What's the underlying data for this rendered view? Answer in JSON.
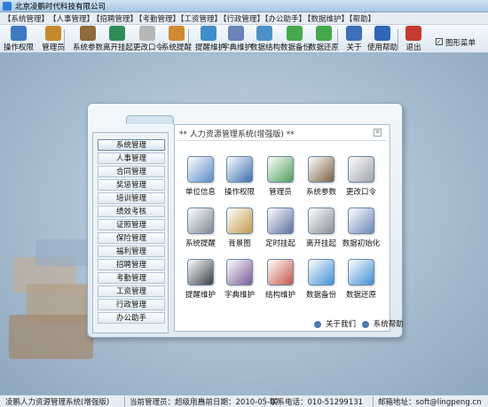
{
  "window": {
    "title": "北京凌鹏时代科技有限公司"
  },
  "menu": [
    "【系统管理】",
    "【人事管理】",
    "【招聘管理】",
    "【考勤管理】",
    "【工资管理】",
    "【行政管理】",
    "【办公助手】",
    "【数据维护】",
    "【帮助】"
  ],
  "toolbar": [
    {
      "label": "操作权限",
      "icon": "user-key-icon",
      "color": "#3d7ac1"
    },
    {
      "label": "管理员",
      "icon": "admin-icon",
      "color": "#c58a2c"
    },
    {
      "label": "系统参数",
      "icon": "settings-icon",
      "color": "#8f6a3a"
    },
    {
      "label": "离开挂起",
      "icon": "suspend-icon",
      "color": "#2e8b57"
    },
    {
      "label": "更改口令",
      "icon": "password-icon",
      "color": "#b7b7b7"
    },
    {
      "label": "系统提醒",
      "icon": "reminder-icon",
      "color": "#d08a2f"
    },
    {
      "label": "提醒维护",
      "icon": "reminder-maintain-icon",
      "color": "#3f8ec9"
    },
    {
      "label": "字典维护",
      "icon": "dictionary-icon",
      "color": "#6a83b8"
    },
    {
      "label": "数据结构",
      "icon": "data-structure-icon",
      "color": "#4b91c7"
    },
    {
      "label": "数据备份",
      "icon": "backup-icon",
      "color": "#45a84d"
    },
    {
      "label": "数据还原",
      "icon": "restore-icon",
      "color": "#45a84d"
    },
    {
      "label": "关于",
      "icon": "about-icon",
      "color": "#3c6fb7"
    },
    {
      "label": "使用帮助",
      "icon": "help-icon",
      "color": "#2f66b5"
    },
    {
      "label": "退出",
      "icon": "exit-icon",
      "color": "#c23b2e"
    }
  ],
  "graphic_menu": {
    "label": "图形菜单",
    "checked": true
  },
  "panel": {
    "title": "** 人力资源管理系统(增强版) **",
    "close": "✕"
  },
  "nav": [
    "系统管理",
    "人事管理",
    "合同管理",
    "奖惩管理",
    "培训管理",
    "绩效考核",
    "证照管理",
    "保险管理",
    "福利管理",
    "招聘管理",
    "考勤管理",
    "工资管理",
    "行政管理",
    "办公助手"
  ],
  "tiles": [
    {
      "label": "单位信息",
      "icon": "company-info-icon",
      "color": "#5b8cc6"
    },
    {
      "label": "操作权限",
      "icon": "operation-permission-icon",
      "color": "#3b6fae"
    },
    {
      "label": "管理员",
      "icon": "administrator-icon",
      "color": "#4f9d5a"
    },
    {
      "label": "系统参数",
      "icon": "system-params-icon",
      "color": "#7a6040"
    },
    {
      "label": "更改口令",
      "icon": "change-password-icon",
      "color": "#9fa3a8"
    },
    {
      "label": "系统提醒",
      "icon": "system-reminder-icon",
      "color": "#7b8894"
    },
    {
      "label": "背景图",
      "icon": "background-image-icon",
      "color": "#c49a4a"
    },
    {
      "label": "定时挂起",
      "icon": "timed-suspend-icon",
      "color": "#5c6fa1"
    },
    {
      "label": "离开挂起",
      "icon": "leave-suspend-icon",
      "color": "#8a9097"
    },
    {
      "label": "数据初始化",
      "icon": "data-init-icon",
      "color": "#6d86b8"
    },
    {
      "label": "提醒维护",
      "icon": "reminder-maint-icon",
      "color": "#3a3f47"
    },
    {
      "label": "字典维护",
      "icon": "dict-maint-icon",
      "color": "#7a5a98"
    },
    {
      "label": "结构维护",
      "icon": "structure-maint-icon",
      "color": "#c4574a"
    },
    {
      "label": "数据备份",
      "icon": "data-backup-icon",
      "color": "#3f8fd4"
    },
    {
      "label": "数据还原",
      "icon": "data-restore-icon",
      "color": "#3f8fd4"
    }
  ],
  "bottom": {
    "about": "关于我们",
    "help": "系统帮助"
  },
  "status": [
    "凌鹏人力资源管理系统(增强版)",
    "当前管理员：超级用户",
    "当前日期：2010-05-07",
    "联系电话：010-51299131",
    "邮箱地址：soft@lingpeng.cn"
  ]
}
